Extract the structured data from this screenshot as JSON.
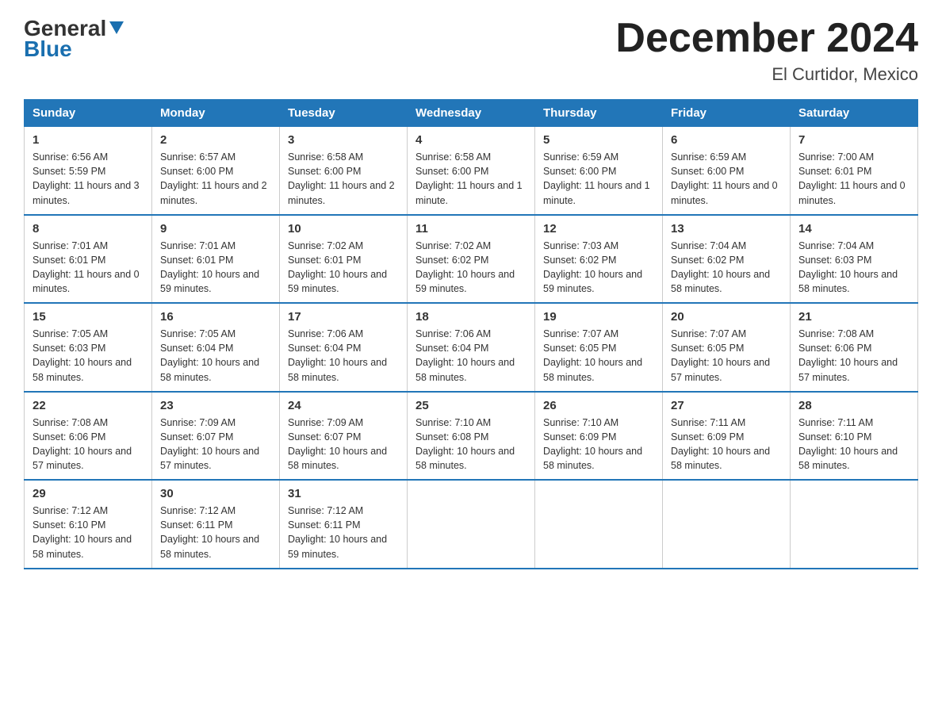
{
  "logo": {
    "general": "General",
    "blue": "Blue",
    "arrow_color": "#1a6faf"
  },
  "header": {
    "month_title": "December 2024",
    "location": "El Curtidor, Mexico"
  },
  "days_of_week": [
    "Sunday",
    "Monday",
    "Tuesday",
    "Wednesday",
    "Thursday",
    "Friday",
    "Saturday"
  ],
  "weeks": [
    [
      {
        "day": "1",
        "sunrise": "Sunrise: 6:56 AM",
        "sunset": "Sunset: 5:59 PM",
        "daylight": "Daylight: 11 hours and 3 minutes."
      },
      {
        "day": "2",
        "sunrise": "Sunrise: 6:57 AM",
        "sunset": "Sunset: 6:00 PM",
        "daylight": "Daylight: 11 hours and 2 minutes."
      },
      {
        "day": "3",
        "sunrise": "Sunrise: 6:58 AM",
        "sunset": "Sunset: 6:00 PM",
        "daylight": "Daylight: 11 hours and 2 minutes."
      },
      {
        "day": "4",
        "sunrise": "Sunrise: 6:58 AM",
        "sunset": "Sunset: 6:00 PM",
        "daylight": "Daylight: 11 hours and 1 minute."
      },
      {
        "day": "5",
        "sunrise": "Sunrise: 6:59 AM",
        "sunset": "Sunset: 6:00 PM",
        "daylight": "Daylight: 11 hours and 1 minute."
      },
      {
        "day": "6",
        "sunrise": "Sunrise: 6:59 AM",
        "sunset": "Sunset: 6:00 PM",
        "daylight": "Daylight: 11 hours and 0 minutes."
      },
      {
        "day": "7",
        "sunrise": "Sunrise: 7:00 AM",
        "sunset": "Sunset: 6:01 PM",
        "daylight": "Daylight: 11 hours and 0 minutes."
      }
    ],
    [
      {
        "day": "8",
        "sunrise": "Sunrise: 7:01 AM",
        "sunset": "Sunset: 6:01 PM",
        "daylight": "Daylight: 11 hours and 0 minutes."
      },
      {
        "day": "9",
        "sunrise": "Sunrise: 7:01 AM",
        "sunset": "Sunset: 6:01 PM",
        "daylight": "Daylight: 10 hours and 59 minutes."
      },
      {
        "day": "10",
        "sunrise": "Sunrise: 7:02 AM",
        "sunset": "Sunset: 6:01 PM",
        "daylight": "Daylight: 10 hours and 59 minutes."
      },
      {
        "day": "11",
        "sunrise": "Sunrise: 7:02 AM",
        "sunset": "Sunset: 6:02 PM",
        "daylight": "Daylight: 10 hours and 59 minutes."
      },
      {
        "day": "12",
        "sunrise": "Sunrise: 7:03 AM",
        "sunset": "Sunset: 6:02 PM",
        "daylight": "Daylight: 10 hours and 59 minutes."
      },
      {
        "day": "13",
        "sunrise": "Sunrise: 7:04 AM",
        "sunset": "Sunset: 6:02 PM",
        "daylight": "Daylight: 10 hours and 58 minutes."
      },
      {
        "day": "14",
        "sunrise": "Sunrise: 7:04 AM",
        "sunset": "Sunset: 6:03 PM",
        "daylight": "Daylight: 10 hours and 58 minutes."
      }
    ],
    [
      {
        "day": "15",
        "sunrise": "Sunrise: 7:05 AM",
        "sunset": "Sunset: 6:03 PM",
        "daylight": "Daylight: 10 hours and 58 minutes."
      },
      {
        "day": "16",
        "sunrise": "Sunrise: 7:05 AM",
        "sunset": "Sunset: 6:04 PM",
        "daylight": "Daylight: 10 hours and 58 minutes."
      },
      {
        "day": "17",
        "sunrise": "Sunrise: 7:06 AM",
        "sunset": "Sunset: 6:04 PM",
        "daylight": "Daylight: 10 hours and 58 minutes."
      },
      {
        "day": "18",
        "sunrise": "Sunrise: 7:06 AM",
        "sunset": "Sunset: 6:04 PM",
        "daylight": "Daylight: 10 hours and 58 minutes."
      },
      {
        "day": "19",
        "sunrise": "Sunrise: 7:07 AM",
        "sunset": "Sunset: 6:05 PM",
        "daylight": "Daylight: 10 hours and 58 minutes."
      },
      {
        "day": "20",
        "sunrise": "Sunrise: 7:07 AM",
        "sunset": "Sunset: 6:05 PM",
        "daylight": "Daylight: 10 hours and 57 minutes."
      },
      {
        "day": "21",
        "sunrise": "Sunrise: 7:08 AM",
        "sunset": "Sunset: 6:06 PM",
        "daylight": "Daylight: 10 hours and 57 minutes."
      }
    ],
    [
      {
        "day": "22",
        "sunrise": "Sunrise: 7:08 AM",
        "sunset": "Sunset: 6:06 PM",
        "daylight": "Daylight: 10 hours and 57 minutes."
      },
      {
        "day": "23",
        "sunrise": "Sunrise: 7:09 AM",
        "sunset": "Sunset: 6:07 PM",
        "daylight": "Daylight: 10 hours and 57 minutes."
      },
      {
        "day": "24",
        "sunrise": "Sunrise: 7:09 AM",
        "sunset": "Sunset: 6:07 PM",
        "daylight": "Daylight: 10 hours and 58 minutes."
      },
      {
        "day": "25",
        "sunrise": "Sunrise: 7:10 AM",
        "sunset": "Sunset: 6:08 PM",
        "daylight": "Daylight: 10 hours and 58 minutes."
      },
      {
        "day": "26",
        "sunrise": "Sunrise: 7:10 AM",
        "sunset": "Sunset: 6:09 PM",
        "daylight": "Daylight: 10 hours and 58 minutes."
      },
      {
        "day": "27",
        "sunrise": "Sunrise: 7:11 AM",
        "sunset": "Sunset: 6:09 PM",
        "daylight": "Daylight: 10 hours and 58 minutes."
      },
      {
        "day": "28",
        "sunrise": "Sunrise: 7:11 AM",
        "sunset": "Sunset: 6:10 PM",
        "daylight": "Daylight: 10 hours and 58 minutes."
      }
    ],
    [
      {
        "day": "29",
        "sunrise": "Sunrise: 7:12 AM",
        "sunset": "Sunset: 6:10 PM",
        "daylight": "Daylight: 10 hours and 58 minutes."
      },
      {
        "day": "30",
        "sunrise": "Sunrise: 7:12 AM",
        "sunset": "Sunset: 6:11 PM",
        "daylight": "Daylight: 10 hours and 58 minutes."
      },
      {
        "day": "31",
        "sunrise": "Sunrise: 7:12 AM",
        "sunset": "Sunset: 6:11 PM",
        "daylight": "Daylight: 10 hours and 59 minutes."
      },
      {
        "day": "",
        "sunrise": "",
        "sunset": "",
        "daylight": ""
      },
      {
        "day": "",
        "sunrise": "",
        "sunset": "",
        "daylight": ""
      },
      {
        "day": "",
        "sunrise": "",
        "sunset": "",
        "daylight": ""
      },
      {
        "day": "",
        "sunrise": "",
        "sunset": "",
        "daylight": ""
      }
    ]
  ]
}
